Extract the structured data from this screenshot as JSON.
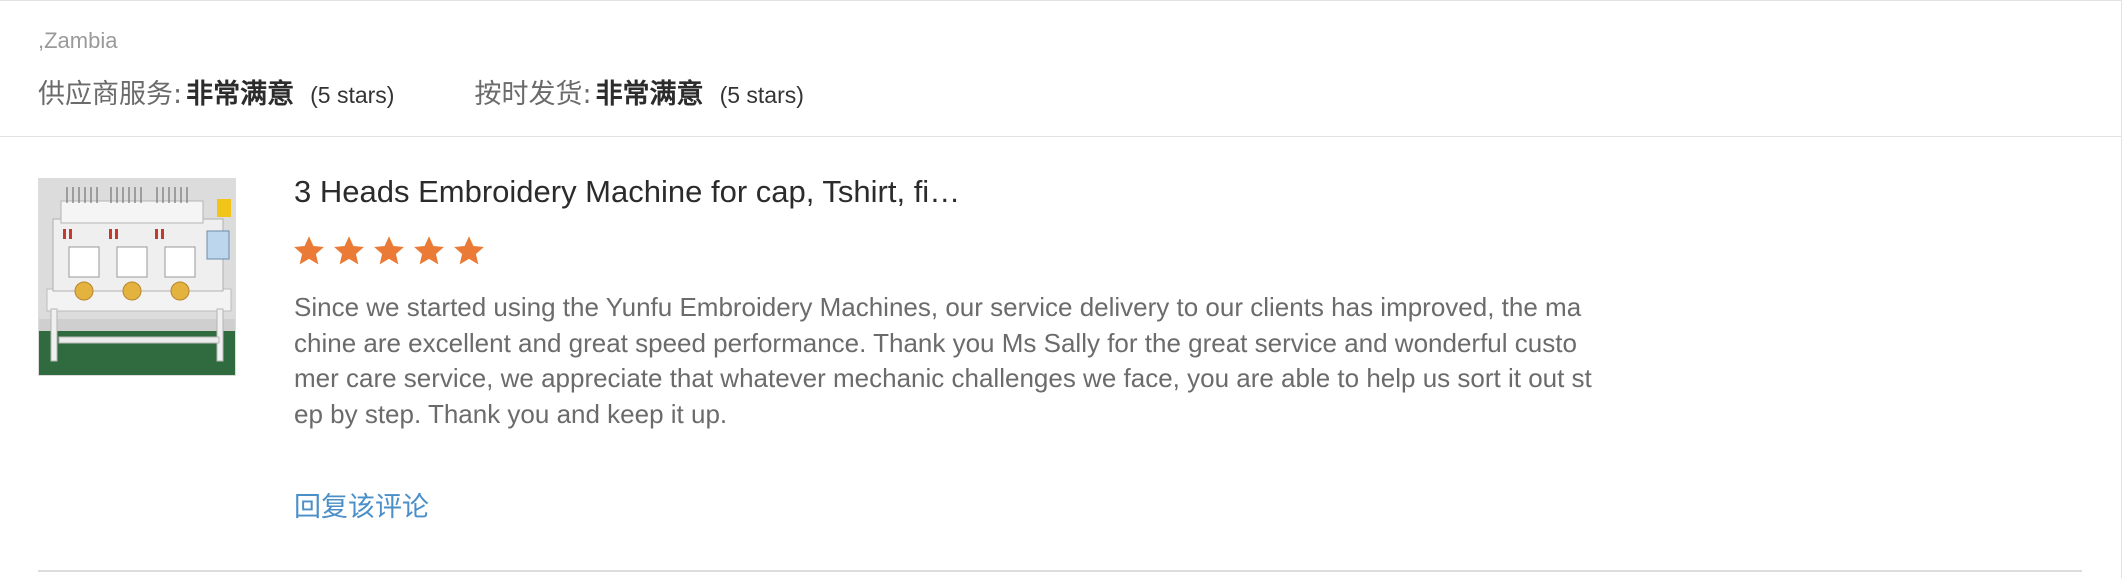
{
  "review": {
    "location": ",Zambia",
    "ratings": [
      {
        "label": "供应商服务:",
        "value": "非常满意",
        "stars": "(5 stars)"
      },
      {
        "label": "按时发货:",
        "value": "非常满意",
        "stars": "(5 stars)"
      }
    ],
    "product": {
      "title": "3 Heads Embroidery Machine for cap, Tshirt, fi…",
      "image_icon": "embroidery-machine-photo",
      "rating": 5,
      "rating_max": 5
    },
    "body": "Since we started using the Yunfu Embroidery Machines, our service delivery to our clients has improved, the machine are excellent and great speed performance. Thank you Ms Sally for the great service and wonderful customer care service, we appreciate that whatever mechanic challenges we face, you are able to help us sort it out step by step. Thank you and keep it up.",
    "reply_label": "回复该评论"
  },
  "colors": {
    "star": "#ea7a35",
    "link": "#4a8fc9",
    "text_muted": "#6b6b6b",
    "text_strong": "#2c2c2c",
    "divider": "#e2e2e2"
  }
}
